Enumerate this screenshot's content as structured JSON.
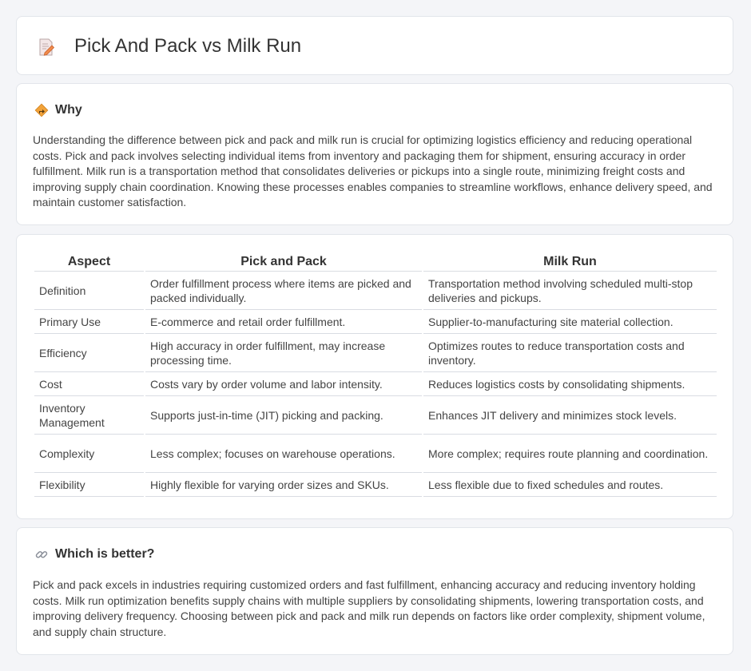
{
  "header": {
    "title": "Pick And Pack vs Milk Run",
    "icon": "document-pen-icon"
  },
  "why": {
    "heading": "Why",
    "icon": "signpost-diamond-icon",
    "text": "Understanding the difference between pick and pack and milk run is crucial for optimizing logistics efficiency and reducing operational costs. Pick and pack involves selecting individual items from inventory and packaging them for shipment, ensuring accuracy in order fulfillment. Milk run is a transportation method that consolidates deliveries or pickups into a single route, minimizing freight costs and improving supply chain coordination. Knowing these processes enables companies to streamline workflows, enhance delivery speed, and maintain customer satisfaction."
  },
  "table": {
    "headers": [
      "Aspect",
      "Pick and Pack",
      "Milk Run"
    ],
    "rows": [
      [
        "Definition",
        "Order fulfillment process where items are picked and packed individually.",
        "Transportation method involving scheduled multi-stop deliveries and pickups."
      ],
      [
        "Primary Use",
        "E-commerce and retail order fulfillment.",
        "Supplier-to-manufacturing site material collection."
      ],
      [
        "Efficiency",
        "High accuracy in order fulfillment, may increase processing time.",
        "Optimizes routes to reduce transportation costs and inventory."
      ],
      [
        "Cost",
        "Costs vary by order volume and labor intensity.",
        "Reduces logistics costs by consolidating shipments."
      ],
      [
        "Inventory Management",
        "Supports just-in-time (JIT) picking and packing.",
        "Enhances JIT delivery and minimizes stock levels."
      ],
      [
        "Complexity",
        "Less complex; focuses on warehouse operations.",
        "More complex; requires route planning and coordination."
      ],
      [
        "Flexibility",
        "Highly flexible for varying order sizes and SKUs.",
        "Less flexible due to fixed schedules and routes."
      ]
    ]
  },
  "better": {
    "heading": "Which is better?",
    "icon": "link-icon",
    "text": "Pick and pack excels in industries requiring customized orders and fast fulfillment, enhancing accuracy and reducing inventory holding costs. Milk run optimization benefits supply chains with multiple suppliers by consolidating shipments, lowering transportation costs, and improving delivery frequency. Choosing between pick and pack and milk run depends on factors like order complexity, shipment volume, and supply chain structure."
  }
}
